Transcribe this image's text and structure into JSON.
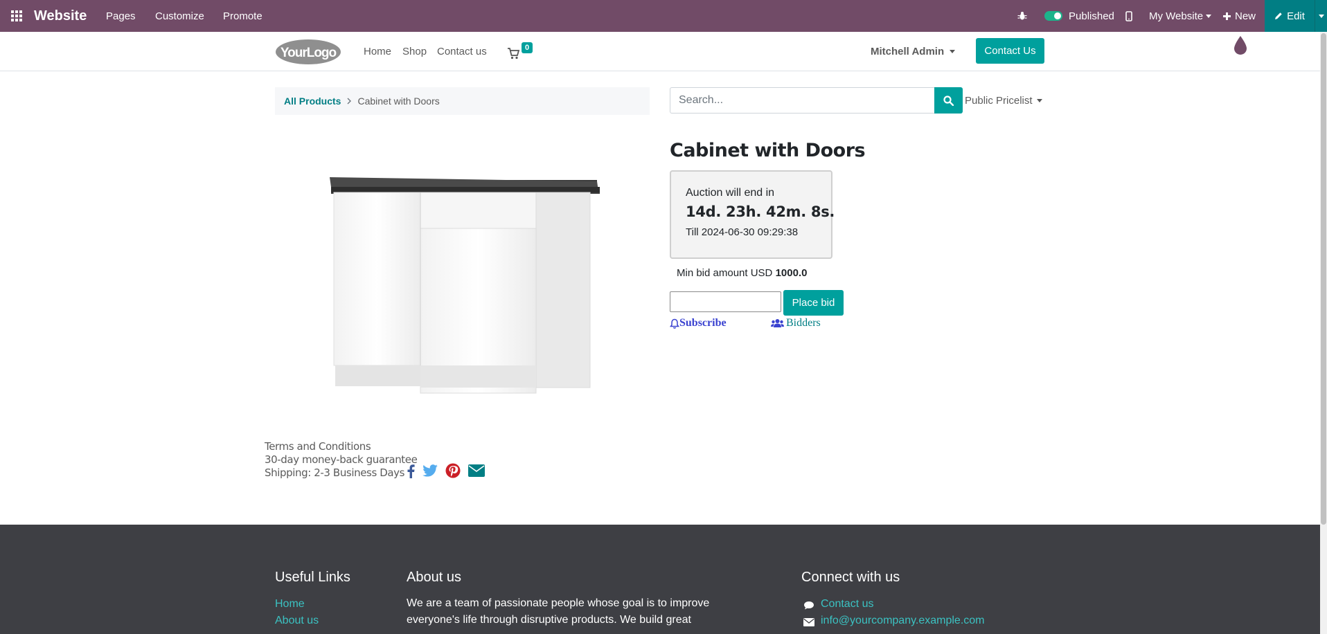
{
  "admin_bar": {
    "app_name": "Website",
    "menu": [
      "Pages",
      "Customize",
      "Promote"
    ],
    "published_label": "Published",
    "website_label": "My Website",
    "new_label": "New",
    "edit_label": "Edit",
    "colors": {
      "bar": "#714B67",
      "edit": "#017e84"
    }
  },
  "header": {
    "logo_text": "YourLogo",
    "nav": [
      "Home",
      "Shop",
      "Contact us"
    ],
    "cart_count": "0",
    "user_name": "Mitchell Admin",
    "cta_label": "Contact Us"
  },
  "breadcrumb": {
    "root": "All Products",
    "current": "Cabinet with Doors"
  },
  "search": {
    "placeholder": "Search...",
    "pricelist_label": "Public Pricelist"
  },
  "product": {
    "title": "Cabinet with Doors",
    "auction_label": "Auction will end in",
    "countdown": "14d. 23h. 42m. 8s.",
    "till_label": "Till 2024-06-30 09:29:38",
    "min_bid_label": "Min bid amount USD",
    "min_bid_value": "1000.0",
    "bid_value": "",
    "place_bid_label": "Place bid",
    "subscribe_label": "Subscribe",
    "bidders_label": "Bidders"
  },
  "terms": {
    "lines": [
      "Terms and Conditions",
      "30-day money-back guarantee",
      "Shipping: 2-3 Business Days"
    ]
  },
  "footer": {
    "useful_links_title": "Useful Links",
    "useful_links": [
      "Home",
      "About us"
    ],
    "about_title": "About us",
    "about_lines": [
      "We are a team of passionate people whose goal is to improve",
      "everyone's life through disruptive products. We build great"
    ],
    "connect_title": "Connect with us",
    "connect_items": [
      "Contact us",
      "info@yourcompany.example.com"
    ]
  },
  "colors": {
    "primary": "#00A09D",
    "footer": "#3e3f44"
  }
}
